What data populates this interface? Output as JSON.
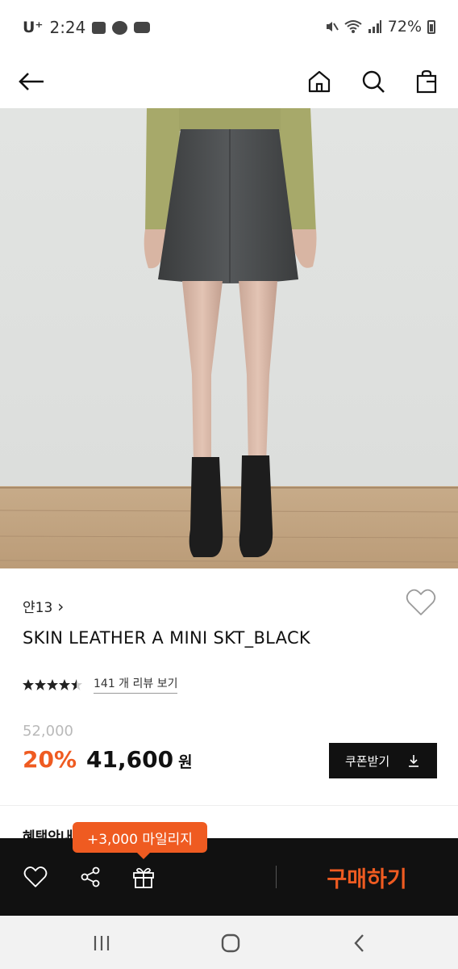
{
  "status_bar": {
    "carrier": "U⁺",
    "time": "2:24",
    "battery": "72%"
  },
  "header": {
    "back_icon": "arrow-left-icon",
    "home_icon": "home-icon",
    "search_icon": "search-icon",
    "bag_icon": "shopping-bag-icon"
  },
  "product": {
    "brand": "얀13",
    "brand_chevron": "›",
    "name": "SKIN LEATHER A MINI SKT_BLACK",
    "rating": 4.5,
    "review_text": "141 개 리뷰 보기",
    "original_price": "52,000",
    "discount": "20%",
    "sale_price": "41,600",
    "currency": "원",
    "coupon_label": "쿠폰받기"
  },
  "benefits": {
    "title": "혜택안내"
  },
  "bottom_bar": {
    "mileage_tip": "+3,000 마일리지",
    "buy_label": "구매하기"
  },
  "colors": {
    "accent": "#ef5b21",
    "dark": "#111111"
  }
}
